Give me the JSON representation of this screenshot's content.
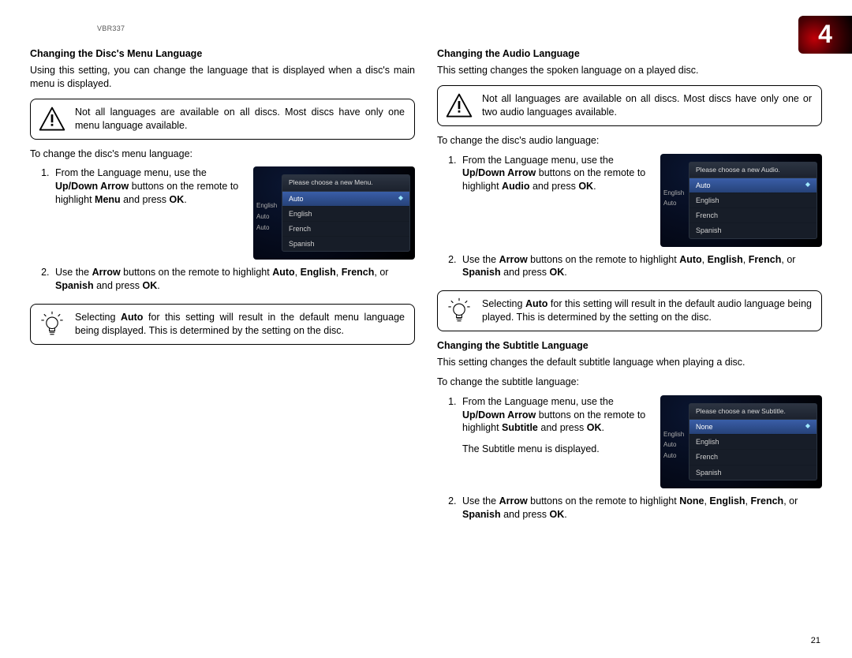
{
  "model": "VBR337",
  "chapter_number": "4",
  "page_number": "21",
  "left": {
    "title": "Changing the Disc's Menu Language",
    "intro": "Using this setting, you can change the language that is displayed when a disc's main menu is displayed.",
    "warning": "Not all languages are available on all discs. Most discs have only one menu language available.",
    "to_change": "To change the disc's menu language:",
    "step1_pre": "From the Language menu, use the ",
    "step1_b1": "Up/Down Arrow",
    "step1_mid": " buttons on the remote to highlight ",
    "step1_b2": "Menu",
    "step1_mid2": " and press ",
    "step1_b3": "OK",
    "step1_end": ".",
    "step2_pre": "Use the ",
    "step2_b1": "Arrow",
    "step2_mid": " buttons on the remote to highlight ",
    "step2_b2": "Auto",
    "step2_c": ", ",
    "step2_b3": "English",
    "step2_b4": "French",
    "step2_or": ", or ",
    "step2_b5": "Spanish",
    "step2_mid2": " and press ",
    "step2_b6": "OK",
    "step2_end": ".",
    "tip_pre": "Selecting ",
    "tip_b": "Auto",
    "tip_post": " for this setting will result in the default menu language being displayed. This is determined by the setting on the disc.",
    "osd": {
      "header": "Please choose a new Menu.",
      "selected": "Auto",
      "items": [
        "Auto",
        "English",
        "French",
        "Spanish"
      ],
      "side": [
        "English",
        "Auto",
        "Auto"
      ]
    }
  },
  "right_audio": {
    "title": "Changing the Audio Language",
    "intro": "This setting changes the spoken language on a played disc.",
    "warning": "Not all languages are available on all discs. Most discs have only one or two audio languages available.",
    "to_change": "To change the disc's audio language:",
    "step1_pre": "From the Language menu, use the ",
    "step1_b1": "Up/Down Arrow",
    "step1_mid": " buttons on the remote to highlight ",
    "step1_b2": "Audio",
    "step1_mid2": " and press ",
    "step1_b3": "OK",
    "step1_end": ".",
    "step2_pre": "Use the ",
    "step2_b1": "Arrow",
    "step2_mid": " buttons on the remote to highlight ",
    "step2_b2": "Auto",
    "step2_c": ", ",
    "step2_b3": "English",
    "step2_b4": "French",
    "step2_or": ", or ",
    "step2_b5": "Spanish",
    "step2_mid2": " and press ",
    "step2_b6": "OK",
    "step2_end": ".",
    "tip_pre": "Selecting ",
    "tip_b": "Auto",
    "tip_post": " for this setting will result in the default audio language being played. This is determined by the setting on the disc.",
    "osd": {
      "header": "Please choose a new Audio.",
      "selected": "Auto",
      "items": [
        "Auto",
        "English",
        "French",
        "Spanish"
      ],
      "side": [
        "English",
        "Auto"
      ]
    }
  },
  "right_subtitle": {
    "title": "Changing the Subtitle Language",
    "intro": "This setting changes the default subtitle language when playing a disc.",
    "to_change": "To change the subtitle language:",
    "step1_pre": "From the Language menu, use the ",
    "step1_b1": "Up/Down Arrow",
    "step1_mid": " buttons on the remote to highlight ",
    "step1_b2": "Subtitle",
    "step1_mid2": " and press ",
    "step1_b3": "OK",
    "step1_end": ".",
    "step1_extra": "The Subtitle menu is displayed.",
    "step2_pre": "Use the ",
    "step2_b1": "Arrow",
    "step2_mid": " buttons on the remote to highlight ",
    "step2_b2": "None",
    "step2_c": ", ",
    "step2_b3": "English",
    "step2_b4": "French",
    "step2_or": ", or ",
    "step2_b5": "Spanish",
    "step2_mid2": " and press ",
    "step2_b6": "OK",
    "step2_end": ".",
    "osd": {
      "header": "Please choose a new Subtitle.",
      "selected": "None",
      "items": [
        "None",
        "English",
        "French",
        "Spanish"
      ],
      "side": [
        "English",
        "Auto",
        "Auto"
      ]
    }
  }
}
